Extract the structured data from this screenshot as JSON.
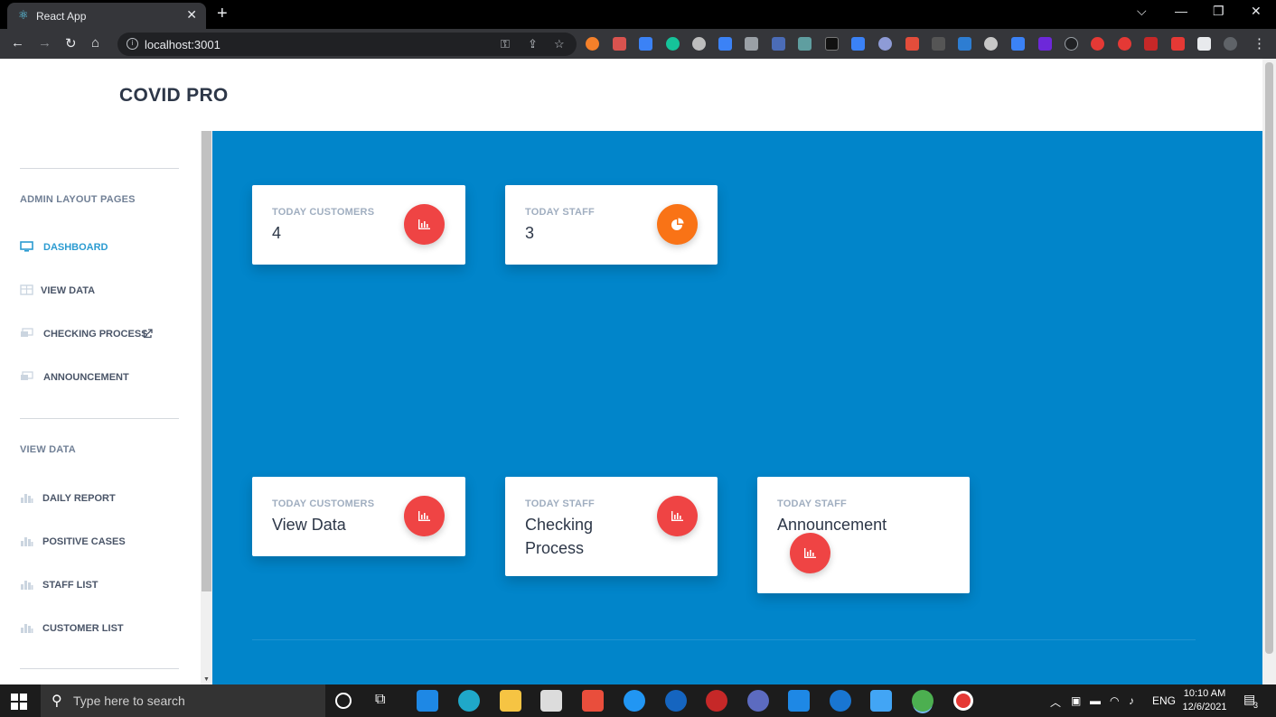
{
  "browser": {
    "tab_title": "React App",
    "close_glyph": "✕",
    "new_tab_glyph": "+",
    "url": "localhost:3001",
    "window_controls": [
      "⌵",
      "—",
      "❐",
      "✕"
    ],
    "nav_glyphs": [
      "←",
      "→",
      "↻",
      "⌂"
    ]
  },
  "app": {
    "brand": "COVID PRO"
  },
  "sidebar": {
    "section1_heading": "ADMIN LAYOUT PAGES",
    "items1": [
      {
        "label": "DASHBOARD",
        "icon": "monitor-icon",
        "active": true
      },
      {
        "label": "VIEW DATA",
        "icon": "table-icon"
      },
      {
        "label": "CHECKING PROCESS",
        "icon": "chat-icon",
        "external": true
      },
      {
        "label": "ANNOUNCEMENT",
        "icon": "chat-icon"
      }
    ],
    "section2_heading": "VIEW DATA",
    "items2": [
      {
        "label": "DAILY REPORT",
        "icon": "chart-icon"
      },
      {
        "label": "POSITIVE CASES",
        "icon": "chart-icon"
      },
      {
        "label": "STAFF LIST",
        "icon": "chart-icon"
      },
      {
        "label": "CUSTOMER LIST",
        "icon": "chart-icon"
      }
    ]
  },
  "cards_top": [
    {
      "label": "TODAY CUSTOMERS",
      "value": "4",
      "icon": "bar-chart-icon",
      "color": "#ef4444"
    },
    {
      "label": "TODAY STAFF",
      "value": "3",
      "icon": "pie-chart-icon",
      "color": "#f97316"
    }
  ],
  "cards_bottom": [
    {
      "label": "TODAY CUSTOMERS",
      "value": "View Data",
      "icon": "bar-chart-icon",
      "color": "#ef4444"
    },
    {
      "label": "TODAY STAFF",
      "value": "Checking Process",
      "icon": "bar-chart-icon",
      "color": "#ef4444"
    },
    {
      "label": "TODAY STAFF",
      "value": "Announcement",
      "icon": "bar-chart-icon",
      "color": "#ef4444"
    }
  ],
  "colors": {
    "main_bg": "#0185ca",
    "active_link": "#2b9bd1"
  },
  "taskbar": {
    "search_placeholder": "Type here to search",
    "language": "ENG",
    "time": "10:10 AM",
    "date": "12/6/2021",
    "notification_count": "3"
  }
}
